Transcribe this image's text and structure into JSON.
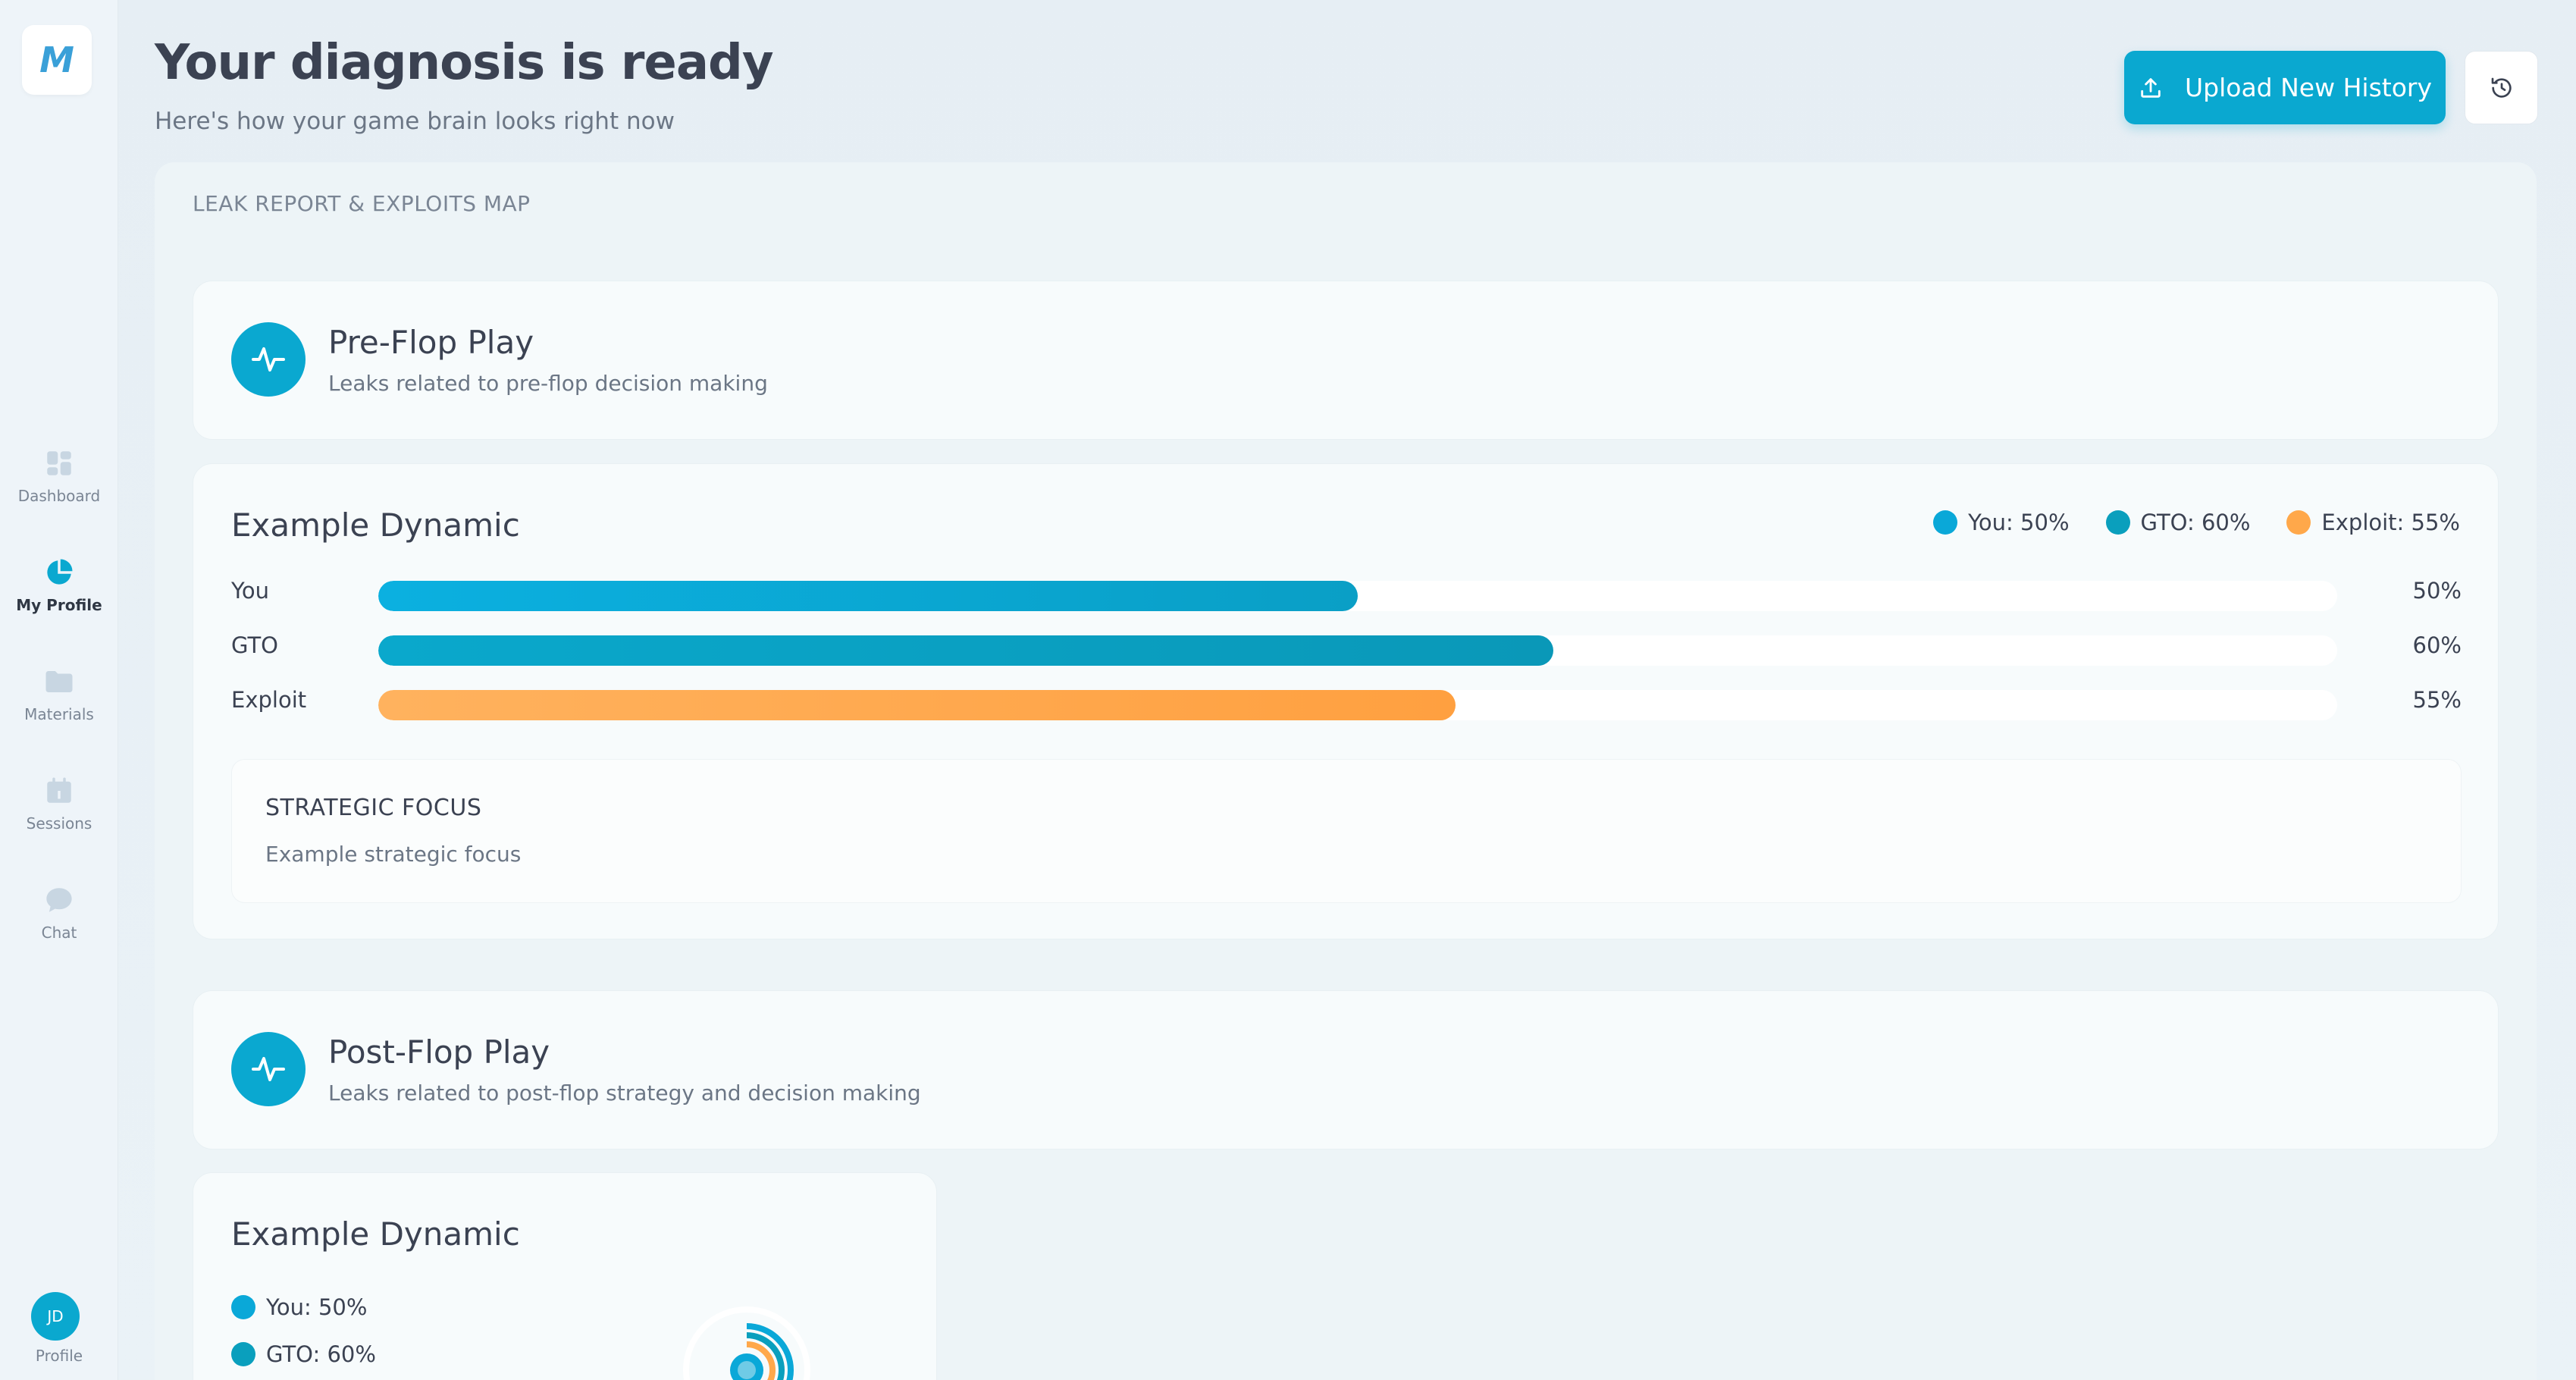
{
  "sidebar": {
    "logo": "M",
    "items": [
      {
        "label": "Dashboard",
        "icon": "dashboard-icon"
      },
      {
        "label": "My Profile",
        "icon": "pie-chart-icon",
        "active": true
      },
      {
        "label": "Materials",
        "icon": "folder-icon"
      },
      {
        "label": "Sessions",
        "icon": "calendar-icon"
      },
      {
        "label": "Chat",
        "icon": "chat-bubble-icon"
      }
    ],
    "profile": {
      "initials": "JD",
      "label": "Profile"
    }
  },
  "header": {
    "title": "Your diagnosis is ready",
    "subtitle": "Here's how your game brain looks right now",
    "upload_label": "Upload New History",
    "upload_icon": "upload-icon",
    "history_icon": "history-icon"
  },
  "panel": {
    "label": "LEAK REPORT & EXPLOITS MAP",
    "sections": [
      {
        "title": "Pre-Flop Play",
        "desc": "Leaks related to pre-flop decision making",
        "icon": "pulse-icon"
      },
      {
        "title": "Post-Flop Play",
        "desc": "Leaks related to post-flop strategy and decision making",
        "icon": "pulse-icon"
      }
    ],
    "dynamic_1": {
      "title": "Example Dynamic",
      "legend": [
        "You: 50%",
        "GTO: 60%",
        "Exploit: 55%"
      ],
      "focus_title": "STRATEGIC FOCUS",
      "focus_text": "Example strategic focus"
    },
    "dynamic_2": {
      "title": "Example Dynamic",
      "legend": [
        "You: 50%",
        "GTO: 60%"
      ]
    }
  },
  "colors": {
    "you": "#0aa8d8",
    "gto": "#0a9fbd",
    "exploit": "#ffa84a",
    "accent": "#0aa8d0"
  },
  "chart_data": [
    {
      "type": "bar",
      "title": "Example Dynamic",
      "categories": [
        "You",
        "GTO",
        "Exploit"
      ],
      "values": [
        50,
        60,
        55
      ],
      "value_labels": [
        "50%",
        "60%",
        "55%"
      ],
      "ylim": [
        0,
        100
      ]
    },
    {
      "type": "pie",
      "title": "Example Dynamic",
      "categories": [
        "You",
        "GTO",
        "Exploit"
      ],
      "values": [
        50,
        60,
        55
      ]
    }
  ]
}
